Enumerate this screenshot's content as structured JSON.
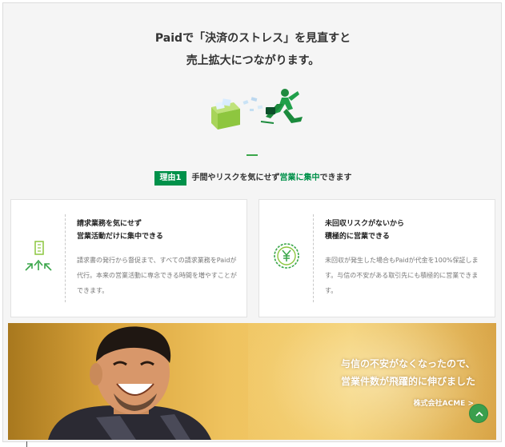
{
  "headline": {
    "line1": "Paidで「決済のストレス」を見直すと",
    "line2": "売上拡大につながります。"
  },
  "reason": {
    "badge": "理由1",
    "text_before": "手間やリスクを気にせず",
    "text_highlight": "営業に集中",
    "text_after": "できます"
  },
  "cards": [
    {
      "title": "請求業務を気にせず\n営業活動だけに集中できる",
      "body": "請求書の発行から督促まで、すべての請求業務をPaidが代行。本来の営業活動に専念できる時間を増やすことができます。",
      "icon": "building-arrows-icon"
    },
    {
      "title": "未回収リスクがないから\n積極的に営業できる",
      "body": "未回収が発生した場合もPaidが代金を100%保証します。与信の不安がある取引先にも積極的に営業できます。",
      "icon": "yen-seal-icon"
    }
  ],
  "testimonial": {
    "quote": "与信の不安がなくなったので、\n営業件数が飛躍的に伸びました",
    "company": "株式会社ACME",
    "company_arrow": ">"
  },
  "colors": {
    "brand_green": "#00914a",
    "accent_green": "#3aa64a",
    "photo_gold": "#efc35f"
  }
}
